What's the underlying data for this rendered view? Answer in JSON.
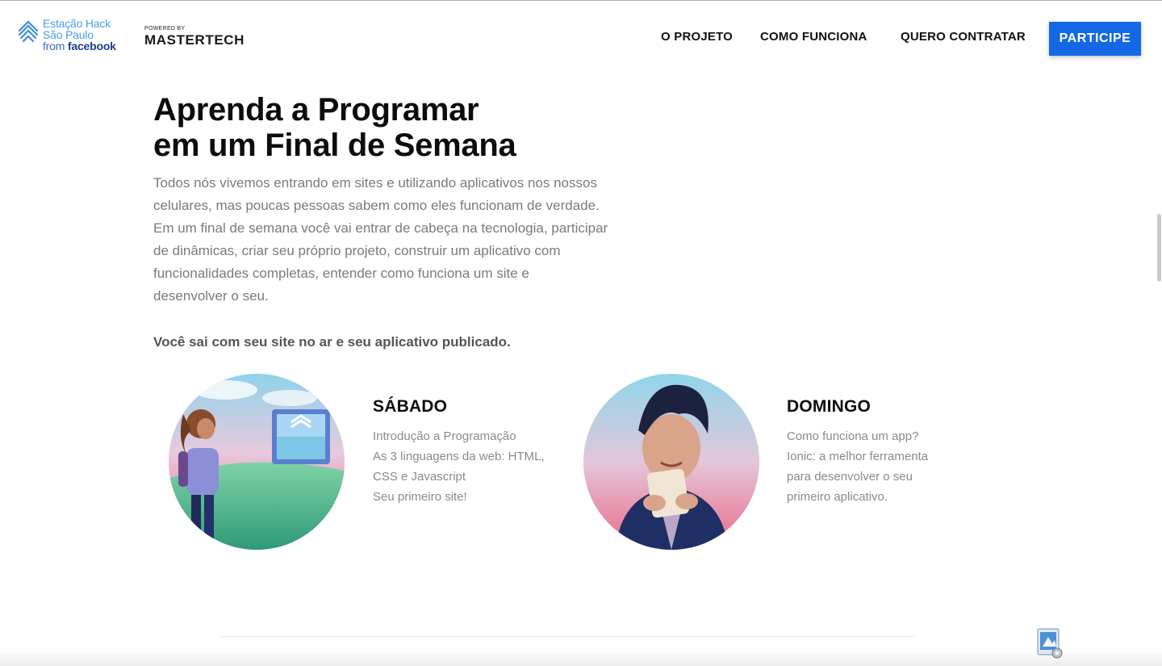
{
  "brand": {
    "line1": "Estação Hack",
    "line2": "São Paulo",
    "line3_prefix": "from ",
    "line3_brand": "facebook",
    "powered_small": "POWERED BY",
    "powered_name": "MASTERTECH"
  },
  "nav": {
    "items": [
      "O PROJETO",
      "COMO FUNCIONA",
      "QUERO CONTRATAR"
    ],
    "cta": "PARTICIPE"
  },
  "hero": {
    "title_line1": "Aprenda a Programar",
    "title_line2": "em um Final de Semana",
    "intro_lines": [
      "Todos nós vivemos entrando em sites e utilizando aplicativos nos nossos",
      "celulares, mas poucas pessoas sabem como eles funcionam de verdade.",
      "Em um final de semana você vai entrar de cabeça na tecnologia, participar",
      "de dinâmicas, criar seu próprio projeto, construir um aplicativo com",
      "funcionalidades completas, entender como funciona um site e",
      "desenvolver o seu."
    ],
    "highlight": "Você sai com seu site no ar e seu aplicativo publicado."
  },
  "days": [
    {
      "title": "SÁBADO",
      "lines": [
        "Introdução a Programação",
        "As 3 linguagens da web: HTML,",
        "CSS e Javascript",
        "Seu primeiro site!"
      ]
    },
    {
      "title": "DOMINGO",
      "lines": [
        "Como funciona um app?",
        "Ionic: a melhor ferramenta",
        "para desenvolver o seu",
        "primeiro aplicativo."
      ]
    }
  ],
  "colors": {
    "accent": "#1468e3",
    "brand_blue": "#4a9fe0",
    "text_gray": "#7a7a7a"
  },
  "icons": {
    "brand_mark": "estacao-hack-logo-icon",
    "dock": "preview-app-icon"
  }
}
